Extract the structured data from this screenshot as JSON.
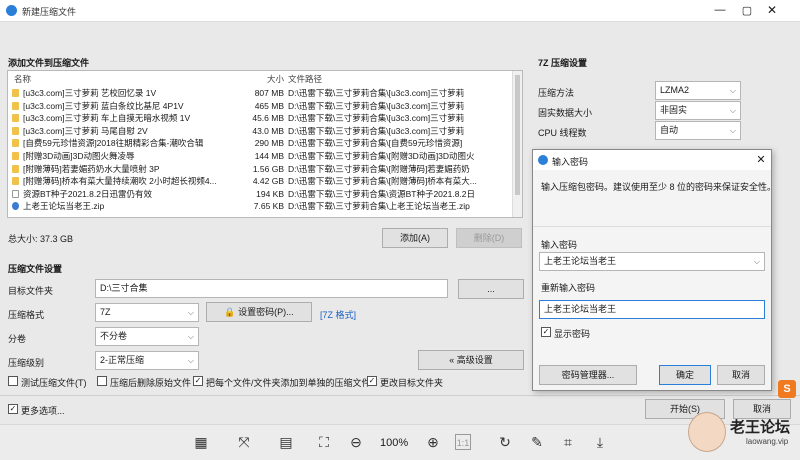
{
  "window": {
    "title": "新建压缩文件"
  },
  "files_section": {
    "heading": "添加文件到压缩文件",
    "columns": {
      "name": "名称",
      "size": "大小",
      "path": "文件路径"
    },
    "rows": [
      {
        "name": "[u3c3.com]三寸萝莉 艺校回忆录 1V",
        "size": "807 MB",
        "path": "D:\\迅雷下载\\三寸萝莉合集\\[u3c3.com]三寸萝莉"
      },
      {
        "name": "[u3c3.com]三寸萝莉 蓝白条纹比基尼 4P1V",
        "size": "465 MB",
        "path": "D:\\迅雷下载\\三寸萝莉合集\\[u3c3.com]三寸萝莉"
      },
      {
        "name": "[u3c3.com]三寸萝莉 车上自摸无暗水视频 1V",
        "size": "45.6 MB",
        "path": "D:\\迅雷下载\\三寸萝莉合集\\[u3c3.com]三寸萝莉"
      },
      {
        "name": "[u3c3.com]三寸萝莉 马尾自慰 2V",
        "size": "43.0 MB",
        "path": "D:\\迅雷下载\\三寸萝莉合集\\[u3c3.com]三寸萝莉"
      },
      {
        "name": "[自费59元珍惜资源]2018往期精彩合集-潮吹合辑",
        "size": "290 MB",
        "path": "D:\\迅雷下载\\三寸萝莉合集\\[自费59元珍惜资源]"
      },
      {
        "name": "[附赠3D动画]3D动图火舞凌辱",
        "size": "144 MB",
        "path": "D:\\迅雷下载\\三寸萝莉合集\\[附赠3D动画]3D动图火"
      },
      {
        "name": "[附赠薄码]若妻媚药奶水大量喷射 3P",
        "size": "1.56 GB",
        "path": "D:\\迅雷下载\\三寸萝莉合集\\[附赠薄码]若妻媚药奶"
      },
      {
        "name": "[附赠薄码]桥本有菜大量持续潮吹 2小时超长视频4...",
        "size": "4.42 GB",
        "path": "D:\\迅雷下载\\三寸萝莉合集\\[附赠薄码]桥本有菜大..."
      },
      {
        "name": "资源BT种子2021.8.2日迅雷仍有效",
        "size": "194 KB",
        "path": "D:\\迅雷下载\\三寸萝莉合集\\资源BT种子2021.8.2日"
      },
      {
        "name": "上老王论坛当老王.zip",
        "size": "7.65 KB",
        "path": "D:\\迅雷下载\\三寸萝莉合集\\上老王论坛当老王.zip"
      }
    ],
    "total": "总大小: 37.3 GB",
    "add_label": "添加(A)",
    "delete_label": "删除(D)"
  },
  "settings": {
    "heading": "压缩文件设置",
    "target_label": "目标文件夹",
    "target_value": "D:\\三寸合集",
    "browse_label": "...",
    "format_label": "压缩格式",
    "format_value": "7Z",
    "set_password_label": "设置密码(P)...",
    "format_link": "[7Z 格式]",
    "split_label": "分卷",
    "split_value": "不分卷",
    "level_label": "压缩级别",
    "level_value": "2-正常压缩",
    "advanced_label": "« 高级设置",
    "opt_test": "测试压缩文件(T)",
    "opt_delete": "压缩后删除原始文件",
    "opt_each": "把每个文件/文件夹添加到单独的压缩文件",
    "opt_change": "更改目标文件夹",
    "more_options": "更多选项...",
    "start_label": "开始(S)",
    "cancel_label": "取消"
  },
  "sevenz": {
    "heading": "7Z 压缩设置",
    "method_label": "压缩方法",
    "method_value": "LZMA2",
    "solid_label": "固实数据大小",
    "solid_value": "非固实",
    "threads_label": "CPU 线程数",
    "threads_value": "自动"
  },
  "password_dialog": {
    "title": "输入密码",
    "hint": "输入压缩包密码。建议使用至少 8 位的密码来保证安全性。",
    "pwd_label": "输入密码",
    "pwd_value": "上老王论坛当老王",
    "repwd_label": "重新输入密码",
    "repwd_value": "上老王论坛当老王",
    "show_password": "显示密码",
    "manager_label": "密码管理器...",
    "ok_label": "确定",
    "cancel_label": "取消"
  },
  "viewer_toolbar": {
    "zoom": "100%"
  },
  "watermark": {
    "brand": "老王论坛",
    "url": "laowang.vip",
    "badge": "S"
  }
}
